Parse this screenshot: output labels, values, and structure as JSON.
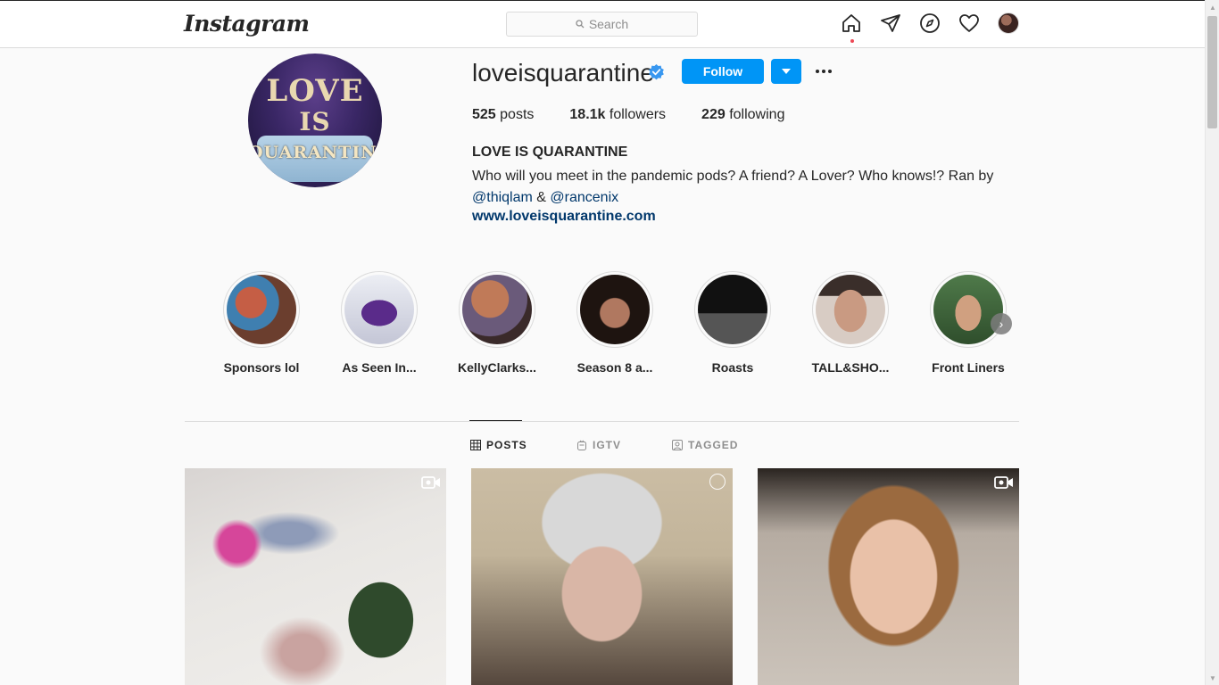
{
  "nav": {
    "logo": "Instagram",
    "search_placeholder": "Search",
    "icons": [
      "home-icon",
      "direct-icon",
      "explore-icon",
      "activity-heart-icon",
      "profile-avatar"
    ]
  },
  "profile": {
    "username": "loveisquarantine",
    "verified": true,
    "follow_label": "Follow",
    "picture_text": {
      "line1": "LOVE",
      "line2": "IS",
      "line3": "QUARANTINE"
    },
    "stats": {
      "posts_count": "525",
      "posts_label": "posts",
      "followers_count": "18.1k",
      "followers_label": "followers",
      "following_count": "229",
      "following_label": "following"
    },
    "full_name": "LOVE IS QUARANTINE",
    "bio_text": "Who will you meet in the pandemic pods? A friend? A Lover? Who knows!? Ran by",
    "bio_mention_1": "@thiqlam",
    "bio_amp": "&",
    "bio_mention_2": "@rancenix",
    "website": "www.loveisquarantine.com"
  },
  "highlights": [
    {
      "label": "Sponsors lol",
      "color": "#c5765a"
    },
    {
      "label": "As Seen In...",
      "color": "#c4c6d6"
    },
    {
      "label": "KellyClarks...",
      "color": "#8a5a4a"
    },
    {
      "label": "Season 8 a...",
      "color": "#5a3226"
    },
    {
      "label": "Roasts",
      "color": "#2a2a2e"
    },
    {
      "label": "TALL&SHO...",
      "color": "#d2c2b6"
    },
    {
      "label": "Front Liners",
      "color": "#4f7a4a"
    }
  ],
  "tabs": {
    "posts": "POSTS",
    "igtv": "IGTV",
    "tagged": "TAGGED"
  },
  "colors": {
    "accent": "#0095f6",
    "link": "#00376b",
    "notification_dot": "#ed4956"
  }
}
